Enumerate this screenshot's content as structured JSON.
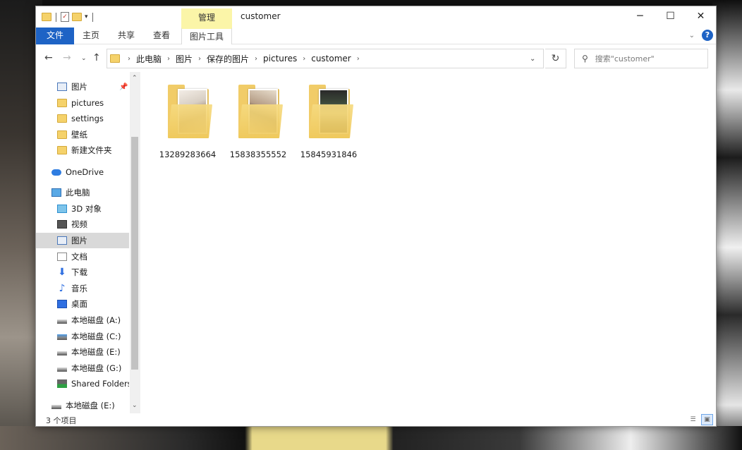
{
  "window": {
    "title": "customer",
    "context_tab_group": "管理",
    "controls": {
      "minimize": "─",
      "maximize": "☐",
      "close": "✕"
    }
  },
  "ribbon": {
    "tabs": [
      {
        "label": "文件"
      },
      {
        "label": "主页"
      },
      {
        "label": "共享"
      },
      {
        "label": "查看"
      },
      {
        "label": "图片工具"
      }
    ],
    "help": "?"
  },
  "address": {
    "breadcrumbs": [
      "此电脑",
      "图片",
      "保存的图片",
      "pictures",
      "customer"
    ],
    "search_placeholder": "搜索\"customer\""
  },
  "navigation": {
    "quick_access": [
      {
        "label": "图片",
        "icon": "pictures-icon",
        "pinned": true
      },
      {
        "label": "pictures",
        "icon": "folder-icon"
      },
      {
        "label": "settings",
        "icon": "folder-icon"
      },
      {
        "label": "壁纸",
        "icon": "folder-icon"
      },
      {
        "label": "新建文件夹",
        "icon": "folder-icon"
      }
    ],
    "onedrive": {
      "label": "OneDrive",
      "icon": "onedrive-icon"
    },
    "this_pc": {
      "label": "此电脑",
      "icon": "computer-icon"
    },
    "pc_items": [
      {
        "label": "3D 对象",
        "icon": "3d-objects-icon"
      },
      {
        "label": "视频",
        "icon": "video-icon"
      },
      {
        "label": "图片",
        "icon": "pictures-icon",
        "selected": true
      },
      {
        "label": "文档",
        "icon": "documents-icon"
      },
      {
        "label": "下载",
        "icon": "download-icon"
      },
      {
        "label": "音乐",
        "icon": "music-icon"
      },
      {
        "label": "桌面",
        "icon": "desktop-icon"
      },
      {
        "label": "本地磁盘 (A:)",
        "icon": "drive-icon"
      },
      {
        "label": "本地磁盘 (C:)",
        "icon": "system-drive-icon"
      },
      {
        "label": "本地磁盘 (E:)",
        "icon": "drive-icon"
      },
      {
        "label": "本地磁盘 (G:)",
        "icon": "drive-icon"
      },
      {
        "label": "Shared Folders",
        "icon": "network-drive-icon"
      }
    ],
    "bottom_item": {
      "label": "本地磁盘 (E:)",
      "icon": "drive-icon"
    }
  },
  "files": [
    {
      "name": "13289283664",
      "type": "folder",
      "preview_colors": [
        "#d8cfc4",
        "#8a6f5c",
        "#f3ede6"
      ]
    },
    {
      "name": "15838355552",
      "type": "folder",
      "preview_colors": [
        "#e7dccb",
        "#b59d86",
        "#4a3c33"
      ]
    },
    {
      "name": "15845931846",
      "type": "folder",
      "preview_colors": [
        "#3d4a3a",
        "#9fae8e",
        "#2a2a2a"
      ]
    }
  ],
  "status": {
    "item_count": "3 个项目"
  },
  "colors": {
    "accent": "#1e63c5",
    "context_tab": "#fbf5a8",
    "folder": "#f1cc68",
    "selection": "#d9d9d9"
  }
}
